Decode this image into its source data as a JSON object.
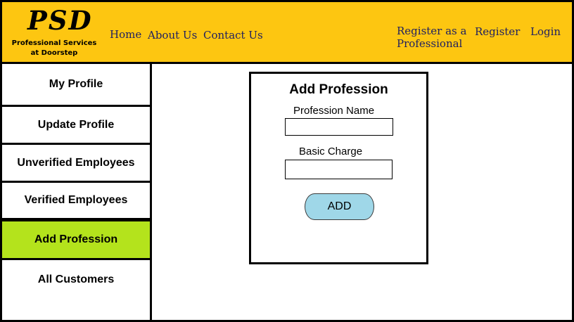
{
  "brand": {
    "logo": "PSD",
    "tagline_line1": "Professional Services",
    "tagline_line2": "at Doorstep"
  },
  "nav": {
    "home": "Home",
    "about": "About Us",
    "contact": "Contact Us",
    "register_professional_line1": "Register as a",
    "register_professional_line2": "Professional",
    "register": "Register",
    "login": "Login"
  },
  "sidebar": {
    "items": [
      {
        "label": "My Profile"
      },
      {
        "label": "Update Profile"
      },
      {
        "label": "Unverified Employees"
      },
      {
        "label": "Verified Employees"
      },
      {
        "label": "Add Profession",
        "active": true
      },
      {
        "label": "All Customers"
      }
    ]
  },
  "form": {
    "title": "Add Profession",
    "profession_name_label": "Profession Name",
    "profession_name_value": "",
    "basic_charge_label": "Basic Charge",
    "basic_charge_value": "",
    "submit_label": "ADD"
  },
  "colors": {
    "header_bg": "#fdc611",
    "active_item_bg": "#b4e31c",
    "button_bg": "#9fd7e8"
  }
}
